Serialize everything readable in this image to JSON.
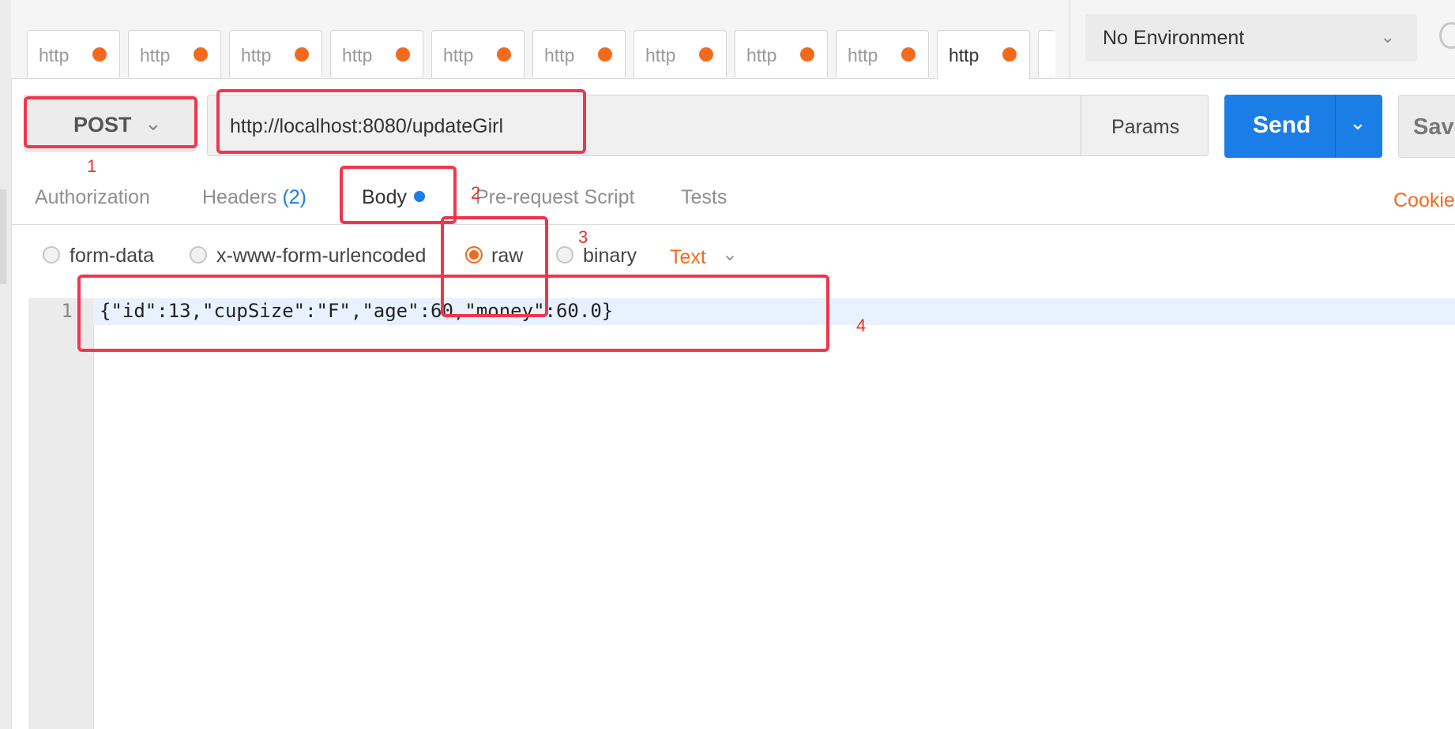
{
  "tabs": {
    "items": [
      {
        "label": "http",
        "active": false
      },
      {
        "label": "http",
        "active": false
      },
      {
        "label": "http",
        "active": false
      },
      {
        "label": "http",
        "active": false
      },
      {
        "label": "http",
        "active": false
      },
      {
        "label": "http",
        "active": false
      },
      {
        "label": "http",
        "active": false
      },
      {
        "label": "http",
        "active": false
      },
      {
        "label": "http",
        "active": false
      },
      {
        "label": "http",
        "active": true
      }
    ]
  },
  "environment": {
    "selected": "No Environment"
  },
  "request": {
    "method": "POST",
    "url": "http://localhost:8080/updateGirl",
    "params_label": "Params",
    "send_label": "Send",
    "save_label": "Save"
  },
  "subtabs": {
    "authorization": "Authorization",
    "headers": "Headers",
    "headers_count": "(2)",
    "body": "Body",
    "prerequest": "Pre-request Script",
    "tests": "Tests",
    "cookies": "Cookies"
  },
  "body_options": {
    "form_data": "form-data",
    "urlencoded": "x-www-form-urlencoded",
    "raw": "raw",
    "binary": "binary",
    "selected": "raw",
    "content_type": "Text"
  },
  "editor": {
    "line_number": "1",
    "code": "{\"id\":13,\"cupSize\":\"F\",\"age\":60,\"money\":60.0}"
  },
  "annotations": {
    "n1": "1",
    "n2": "2",
    "n3": "3",
    "n4": "4"
  },
  "colors": {
    "accent_orange": "#f26b1d",
    "primary_blue": "#1a7ee6",
    "annotation_red": "#f0364d"
  }
}
